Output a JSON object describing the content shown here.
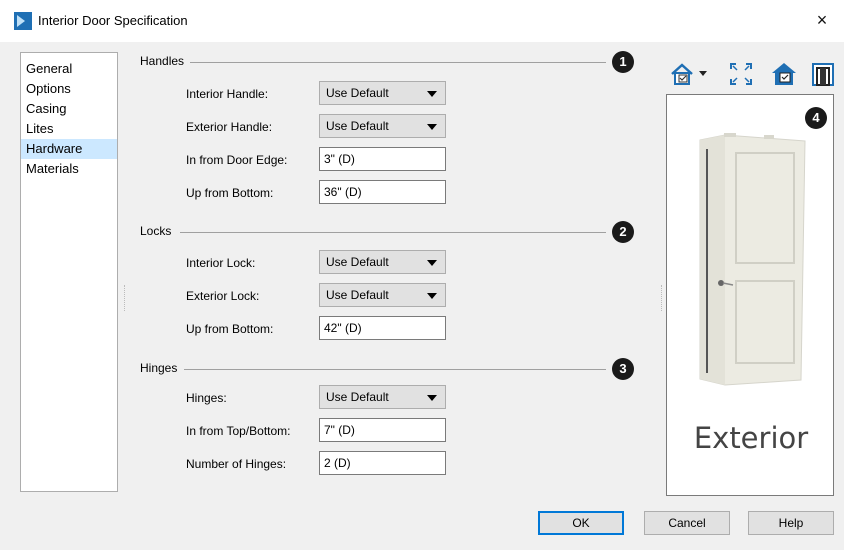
{
  "window": {
    "title": "Interior Door Specification",
    "close_glyph": "×"
  },
  "nav": {
    "items": [
      "General",
      "Options",
      "Casing",
      "Lites",
      "Hardware",
      "Materials"
    ],
    "selected": "Hardware"
  },
  "handles": {
    "title": "Handles",
    "badge": "1",
    "interior_handle_label": "Interior Handle:",
    "interior_handle_value": "Use Default",
    "exterior_handle_label": "Exterior Handle:",
    "exterior_handle_value": "Use Default",
    "in_from_edge_label": "In from Door Edge:",
    "in_from_edge_value": "3\" (D)",
    "up_from_bottom_label": "Up from Bottom:",
    "up_from_bottom_value": "36\" (D)"
  },
  "locks": {
    "title": "Locks",
    "badge": "2",
    "interior_lock_label": "Interior Lock:",
    "interior_lock_value": "Use Default",
    "exterior_lock_label": "Exterior Lock:",
    "exterior_lock_value": "Use Default",
    "up_from_bottom_label": "Up from Bottom:",
    "up_from_bottom_value": "42\" (D)"
  },
  "hinges": {
    "title": "Hinges",
    "badge": "3",
    "hinges_label": "Hinges:",
    "hinges_value": "Use Default",
    "in_from_top_bottom_label": "In from Top/Bottom:",
    "in_from_top_bottom_value": "7\" (D)",
    "number_label": "Number of Hinges:",
    "number_value": "2 (D)"
  },
  "preview": {
    "badge": "4",
    "caption": "Exterior"
  },
  "toolbar": {
    "icons": [
      "view-options-icon",
      "fit-view-icon",
      "elevation-view-icon",
      "door-frame-icon"
    ]
  },
  "buttons": {
    "ok": "OK",
    "cancel": "Cancel",
    "help": "Help"
  },
  "colors": {
    "selection": "#cce8ff",
    "dialog_bg": "#f0f0f0",
    "accent": "#0078d7"
  }
}
